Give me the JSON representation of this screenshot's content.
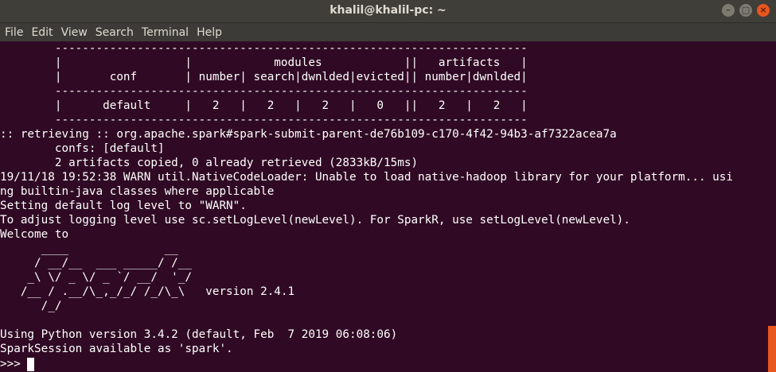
{
  "window": {
    "title": "khalil@khalil-pc: ~",
    "minimize_glyph": "–",
    "maximize_glyph": "□",
    "close_glyph": "×"
  },
  "menu": [
    "File",
    "Edit",
    "View",
    "Search",
    "Terminal",
    "Help"
  ],
  "terminal": {
    "lines": [
      "        ---------------------------------------------------------------------",
      "        |                  |            modules            ||   artifacts   |",
      "        |       conf       | number| search|dwnlded|evicted|| number|dwnlded|",
      "        ---------------------------------------------------------------------",
      "        |      default     |   2   |   2   |   2   |   0   ||   2   |   2   |",
      "        ---------------------------------------------------------------------",
      ":: retrieving :: org.apache.spark#spark-submit-parent-de76b109-c170-4f42-94b3-af7322acea7a",
      "        confs: [default]",
      "        2 artifacts copied, 0 already retrieved (2833kB/15ms)",
      "19/11/18 19:52:38 WARN util.NativeCodeLoader: Unable to load native-hadoop library for your platform... usi",
      "ng builtin-java classes where applicable",
      "Setting default log level to \"WARN\".",
      "To adjust logging level use sc.setLogLevel(newLevel). For SparkR, use setLogLevel(newLevel).",
      "Welcome to",
      "      ____              __",
      "     / __/__  ___ _____/ /__",
      "    _\\ \\/ _ \\/ _ `/ __/  '_/",
      "   /__ / .__/\\_,_/_/ /_/\\_\\   version 2.4.1",
      "      /_/",
      "",
      "Using Python version 3.4.2 (default, Feb  7 2019 06:08:06)",
      "SparkSession available as 'spark'."
    ],
    "prompt": ">>>"
  },
  "colors": {
    "terminal_bg": "#300a24",
    "titlebar_bg": "#403e39",
    "menubar_bg": "#3c3b37",
    "accent": "#e9561e",
    "text": "#ffffff"
  }
}
